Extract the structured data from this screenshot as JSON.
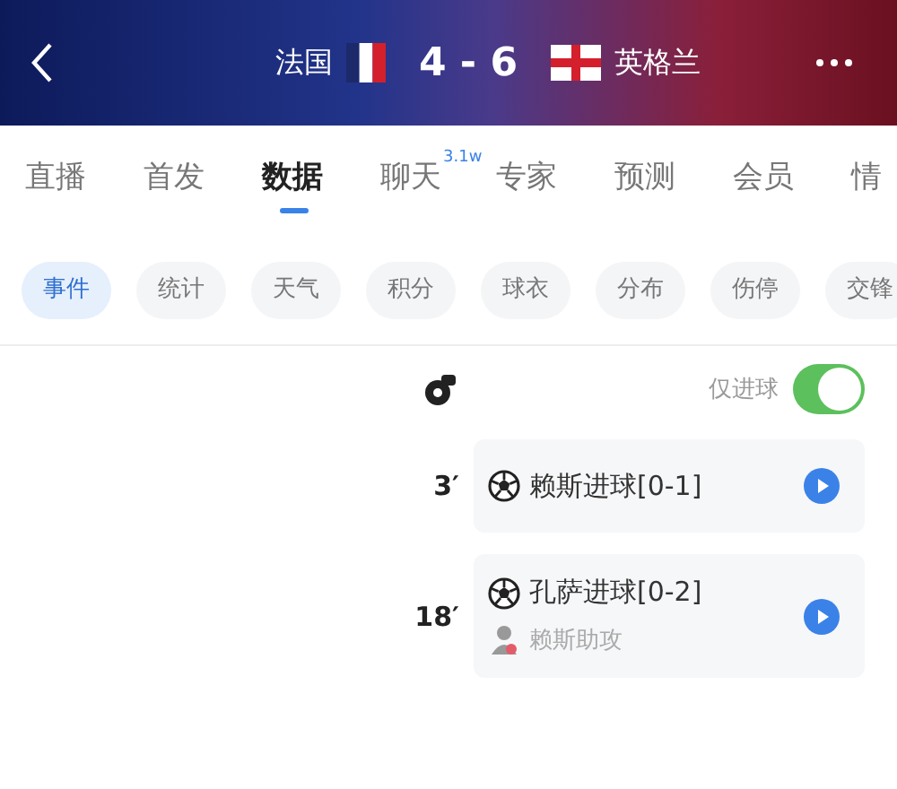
{
  "header": {
    "home_team": "法国",
    "score": "4 - 6",
    "away_team": "英格兰"
  },
  "tabs": [
    {
      "label": "直播",
      "selected": false
    },
    {
      "label": "首发",
      "selected": false
    },
    {
      "label": "数据",
      "selected": true
    },
    {
      "label": "聊天",
      "badge": "3.1w",
      "selected": false
    },
    {
      "label": "专家",
      "selected": false
    },
    {
      "label": "预测",
      "selected": false
    },
    {
      "label": "会员",
      "selected": false
    },
    {
      "label": "情",
      "selected": false
    }
  ],
  "chips": [
    {
      "label": "事件",
      "selected": true
    },
    {
      "label": "统计",
      "selected": false
    },
    {
      "label": "天气",
      "selected": false
    },
    {
      "label": "积分",
      "selected": false
    },
    {
      "label": "球衣",
      "selected": false
    },
    {
      "label": "分布",
      "selected": false
    },
    {
      "label": "伤停",
      "selected": false
    },
    {
      "label": "交锋",
      "selected": false
    }
  ],
  "filter": {
    "label": "仅进球",
    "on": true
  },
  "events": [
    {
      "minute": "3′",
      "text": "赖斯进球[0-1]"
    },
    {
      "minute": "18′",
      "text": "孔萨进球[0-2]",
      "assist": "赖斯助攻"
    }
  ]
}
